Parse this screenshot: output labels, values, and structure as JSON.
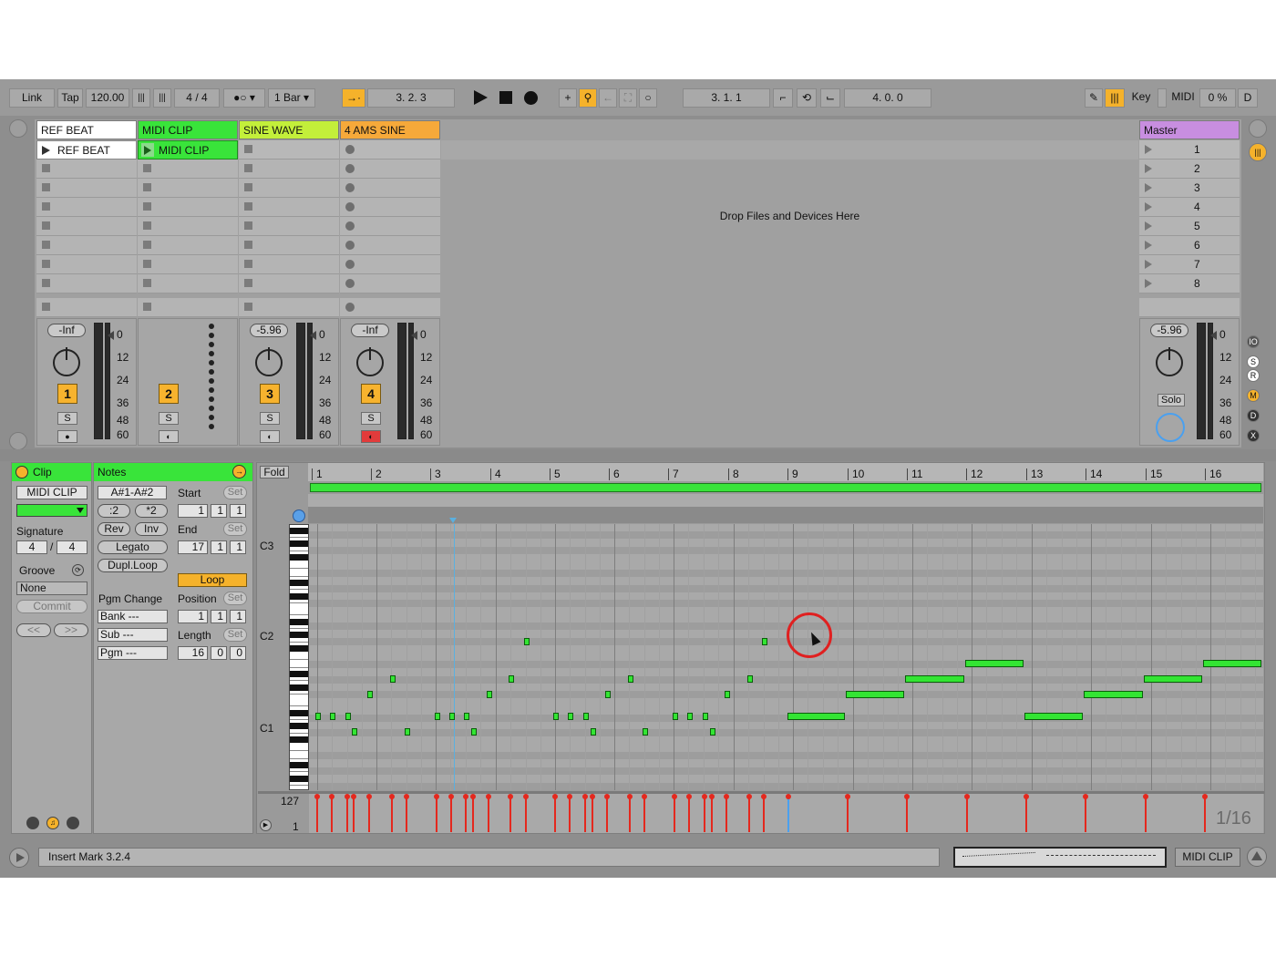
{
  "transport": {
    "link": "Link",
    "tap": "Tap",
    "tempo": "120.00",
    "sig_num": "4",
    "sig_sep": "/",
    "sig_den": "4",
    "quant": "1 Bar",
    "arr_pos": "3.   2.   3",
    "loop_start": "3.   1.   1",
    "loop_len": "4.   0.   0",
    "key": "Key",
    "midi": "MIDI",
    "cpu": "0 %",
    "d": "D"
  },
  "session": {
    "tracks": [
      {
        "name": "REF BEAT",
        "color": "#ffffff",
        "clip": "REF BEAT",
        "volume": "-Inf",
        "number": "1"
      },
      {
        "name": "MIDI CLIP",
        "color": "#39e43a",
        "clip": "MIDI CLIP",
        "volume": "",
        "number": "2"
      },
      {
        "name": "SINE WAVE",
        "color": "#c3ef3a",
        "clip": "",
        "volume": "-5.96",
        "number": "3"
      },
      {
        "name": "4   AMS SINE",
        "color": "#f6a93a",
        "clip": "",
        "volume": "-Inf",
        "number": "4"
      }
    ],
    "drop_hint": "Drop Files and Devices Here",
    "master": {
      "name": "Master",
      "color": "#c88ee0",
      "scenes": [
        "1",
        "2",
        "3",
        "4",
        "5",
        "6",
        "7",
        "8"
      ],
      "volume": "-5.96",
      "solo": "Solo"
    },
    "meter_scale": [
      "0",
      "12",
      "24",
      "36",
      "48",
      "60"
    ],
    "solo_label": "S"
  },
  "clip": {
    "title": "Clip",
    "name": "MIDI CLIP",
    "signature_label": "Signature",
    "sig_num": "4",
    "sig_sep": "/",
    "sig_den": "4",
    "groove_label": "Groove",
    "groove_value": "None",
    "commit": "Commit",
    "prev": "<<",
    "next": ">>"
  },
  "notes": {
    "title": "Notes",
    "range": "A#1-A#2",
    "half": ":2",
    "double": "*2",
    "rev": "Rev",
    "inv": "Inv",
    "legato": "Legato",
    "dupl": "Dupl.Loop",
    "pgm_change": "Pgm Change",
    "bank": "Bank ---",
    "sub": "Sub ---",
    "pgm": "Pgm ---",
    "start_label": "Start",
    "end_label": "End",
    "set": "Set",
    "start": [
      "1",
      "1",
      "1"
    ],
    "end": [
      "17",
      "1",
      "1"
    ],
    "loop": "Loop",
    "position_label": "Position",
    "position": [
      "1",
      "1",
      "1"
    ],
    "length_label": "Length",
    "length": [
      "16",
      "0",
      "0"
    ]
  },
  "editor": {
    "fold": "Fold",
    "bars": [
      "1",
      "2",
      "3",
      "4",
      "5",
      "6",
      "7",
      "8",
      "9",
      "10",
      "11",
      "12",
      "13",
      "14",
      "15",
      "16"
    ],
    "octaves": [
      "C3",
      "C2",
      "C1"
    ],
    "vel_max": "127",
    "vel_min": "1",
    "grid": "1/16"
  },
  "status": {
    "message": "Insert Mark 3.2.4",
    "clip_name": "MIDI CLIP"
  },
  "colors": {
    "accent_green": "#39e43a",
    "accent_orange": "#f6a93a",
    "velocity_red": "#e4281e"
  }
}
